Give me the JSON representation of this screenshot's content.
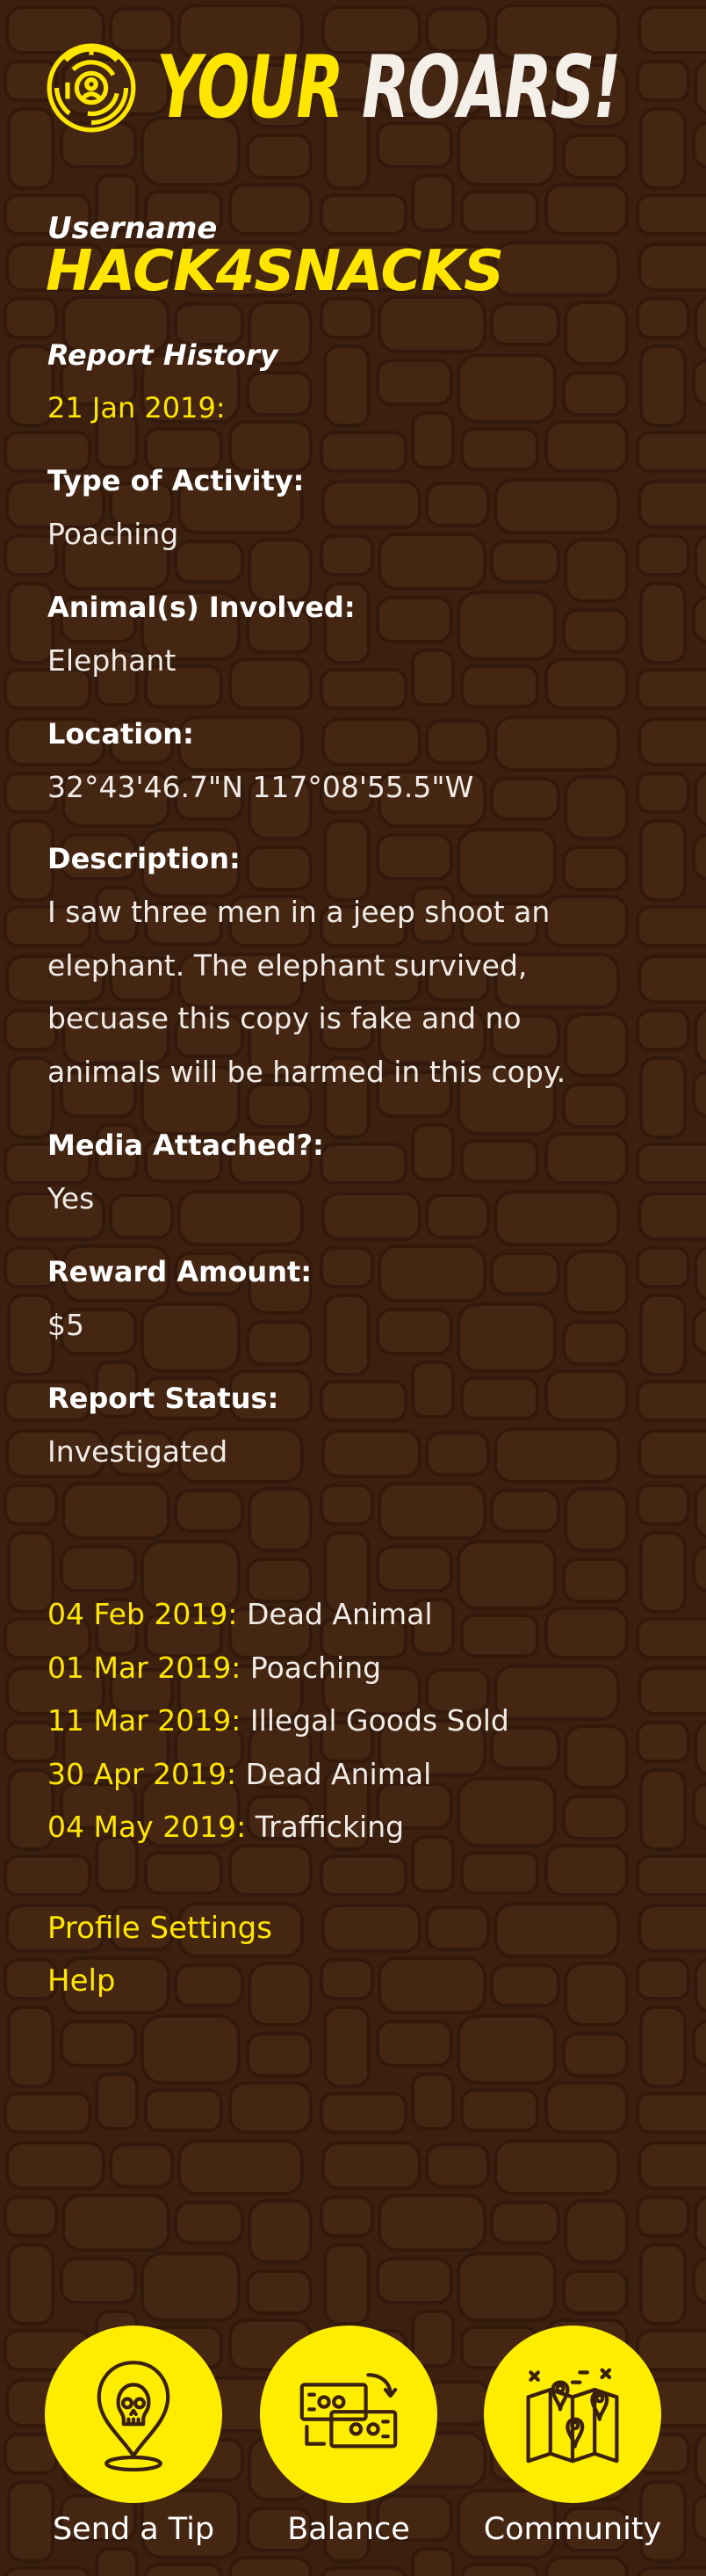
{
  "header": {
    "title_part1": "YOUR",
    "title_part2": "ROARS!",
    "logo_icon": "maze-lion-logo-icon"
  },
  "profile": {
    "username_label": "Username",
    "username": "HACK4SNACKS"
  },
  "report_history": {
    "heading": "Report History",
    "current_report": {
      "date": "21 Jan 2019:",
      "fields": [
        {
          "label": "Type of Activity:",
          "value": "Poaching"
        },
        {
          "label": "Animal(s) Involved:",
          "value": "Elephant"
        },
        {
          "label": "Location:",
          "value": "32°43'46.7\"N 117°08'55.5\"W"
        },
        {
          "label": "Description:",
          "value": "I saw three men in a jeep shoot an elephant. The elephant survived, becuase this copy is fake and no animals will be harmed in this copy."
        },
        {
          "label": "Media Attached?:",
          "value": "Yes"
        },
        {
          "label": "Reward Amount:",
          "value": "$5"
        },
        {
          "label": "Report Status:",
          "value": "Investigated"
        }
      ]
    },
    "other_reports": [
      {
        "date": "04 Feb 2019:",
        "type": "Dead Animal"
      },
      {
        "date": "01 Mar 2019:",
        "type": "Poaching"
      },
      {
        "date": "11 Mar 2019:",
        "type": "Illegal Goods Sold"
      },
      {
        "date": "30 Apr 2019:",
        "type": "Dead Animal"
      },
      {
        "date": "04 May 2019:",
        "type": "Trafficking"
      }
    ]
  },
  "links": {
    "profile_settings": "Profile Settings",
    "help": "Help"
  },
  "bottom_nav": [
    {
      "label": "Send a Tip",
      "icon": "skull-location-pin-icon"
    },
    {
      "label": "Balance",
      "icon": "cash-exchange-icon"
    },
    {
      "label": "Community",
      "icon": "map-pins-icon"
    }
  ],
  "colors": {
    "background": "#3b200f",
    "accent": "#ffe600",
    "text": "#f1ebe6"
  }
}
